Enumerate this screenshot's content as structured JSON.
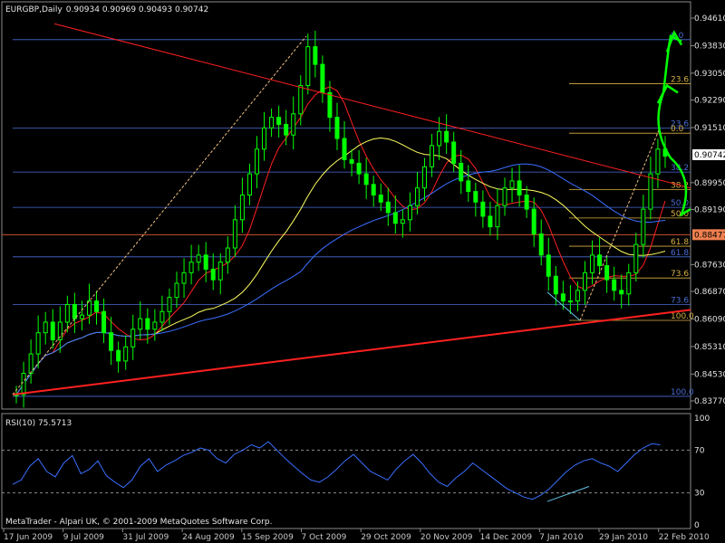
{
  "chart_data": [
    {
      "type": "candlestick",
      "symbol": "EURGBP,Daily",
      "ohlc_header": "0.90934 0.90969 0.90493 0.90742",
      "y_ticks": [
        "0.94610",
        "0.93830",
        "0.93050",
        "0.92290",
        "0.91510",
        "0.90742",
        "0.89950",
        "0.89190",
        "0.88477",
        "0.87630",
        "0.86870",
        "0.86090",
        "0.85310",
        "0.84530",
        "0.83770"
      ],
      "current_price": "0.90742",
      "highlight_price": "0.88477",
      "ylim": [
        0.8377,
        0.9461
      ],
      "x_ticks": [
        "17 Jun 2009",
        "9 Jul 2009",
        "31 Jul 2009",
        "24 Aug 2009",
        "15 Sep 2009",
        "7 Oct 2009",
        "29 Oct 2009",
        "20 Nov 2009",
        "14 Dec 2009",
        "7 Jan 2010",
        "29 Jan 2010",
        "22 Feb 2010"
      ],
      "colors": {
        "candle": "#00ff00",
        "ma_fast": "#ff2020",
        "ma_mid": "#ffff60",
        "ma_slow": "#3a6fff",
        "trend": "#ff2020",
        "fib_blue": "#4a6cd4",
        "fib_gold": "#d8b040",
        "drawing": "#00ff00",
        "grid": "#5a7ad8"
      },
      "close_path": [
        0.8395,
        0.8455,
        0.851,
        0.857,
        0.86,
        0.855,
        0.86,
        0.865,
        0.861,
        0.862,
        0.866,
        0.863,
        0.857,
        0.852,
        0.849,
        0.853,
        0.858,
        0.861,
        0.858,
        0.86,
        0.863,
        0.867,
        0.871,
        0.874,
        0.877,
        0.879,
        0.875,
        0.872,
        0.877,
        0.881,
        0.889,
        0.896,
        0.902,
        0.909,
        0.915,
        0.918,
        0.916,
        0.913,
        0.919,
        0.927,
        0.938,
        0.933,
        0.925,
        0.918,
        0.912,
        0.906,
        0.905,
        0.902,
        0.899,
        0.896,
        0.894,
        0.891,
        0.888,
        0.889,
        0.893,
        0.898,
        0.904,
        0.91,
        0.914,
        0.911,
        0.905,
        0.9,
        0.897,
        0.894,
        0.89,
        0.887,
        0.893,
        0.898,
        0.9,
        0.896,
        0.892,
        0.885,
        0.879,
        0.873,
        0.868,
        0.866,
        0.866,
        0.869,
        0.874,
        0.879,
        0.876,
        0.872,
        0.869,
        0.868,
        0.874,
        0.882,
        0.892,
        0.902,
        0.909,
        0.907
      ],
      "fib_levels_left": [
        "0.0",
        "23.6",
        "38.2",
        "50.0",
        "61.8",
        "73.6",
        "100.0"
      ],
      "fib_levels_right": [
        "23.6",
        "0.0",
        "38.2",
        "50.0",
        "61.8",
        "73.6",
        "100.0"
      ],
      "rsi": {
        "label": "RSI(10) 75.5713",
        "ylim": [
          0,
          100
        ],
        "y_ticks": [
          "100",
          "70",
          "30",
          "0"
        ],
        "levels": [
          70,
          30
        ],
        "values": [
          38,
          42,
          55,
          62,
          50,
          45,
          58,
          65,
          48,
          52,
          60,
          46,
          40,
          35,
          42,
          55,
          62,
          50,
          56,
          60,
          65,
          68,
          72,
          70,
          62,
          58,
          66,
          70,
          75,
          72,
          78,
          70,
          62,
          55,
          48,
          42,
          40,
          45,
          52,
          60,
          66,
          58,
          50,
          46,
          42,
          52,
          60,
          66,
          58,
          48,
          40,
          36,
          44,
          50,
          58,
          52,
          46,
          40,
          34,
          30,
          26,
          24,
          28,
          34,
          42,
          50,
          56,
          60,
          62,
          58,
          55,
          50,
          58,
          66,
          72,
          76,
          75
        ]
      }
    }
  ],
  "footer": "MetaTrader - Alpari UK, © 2001-2009 MetaQuotes Software Corp."
}
